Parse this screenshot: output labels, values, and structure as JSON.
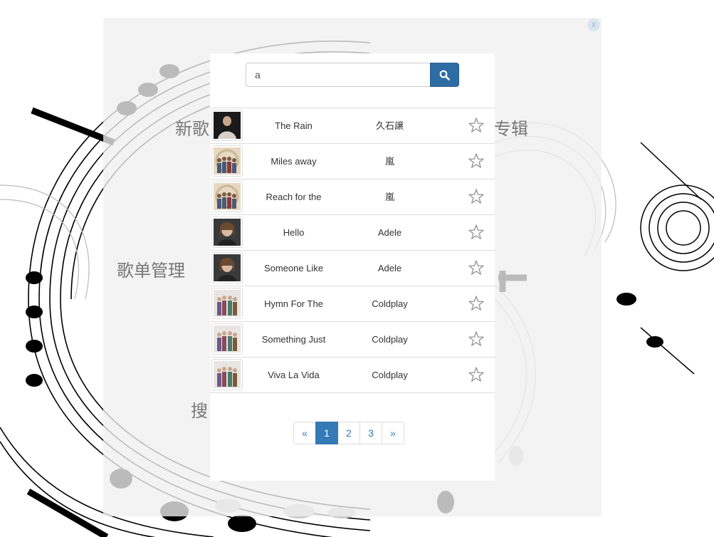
{
  "menu": {
    "new_songs": "新歌",
    "albums": "专辑",
    "playlist_manage": "歌单管理",
    "search": "搜"
  },
  "close_label": "x",
  "search": {
    "value": "a",
    "button_icon": "search-icon"
  },
  "results": [
    {
      "song": "The Rain",
      "artist": "久石譲",
      "thumb": "dark-portrait"
    },
    {
      "song": "Miles away",
      "artist": "嵐",
      "thumb": "group-photo"
    },
    {
      "song": "Reach for the",
      "artist": "嵐",
      "thumb": "group-photo"
    },
    {
      "song": "Hello",
      "artist": "Adele",
      "thumb": "portrait"
    },
    {
      "song": "Someone Like",
      "artist": "Adele",
      "thumb": "portrait"
    },
    {
      "song": "Hymn For The",
      "artist": "Coldplay",
      "thumb": "band-photo"
    },
    {
      "song": "Something Just",
      "artist": "Coldplay",
      "thumb": "band-photo"
    },
    {
      "song": "Viva La Vida",
      "artist": "Coldplay",
      "thumb": "band-photo"
    }
  ],
  "pagination": {
    "prev": "«",
    "pages": [
      "1",
      "2",
      "3"
    ],
    "current": "1",
    "next": "»"
  },
  "colors": {
    "accent": "#337ab7",
    "button": "#2e6da4",
    "star": "#999999"
  }
}
